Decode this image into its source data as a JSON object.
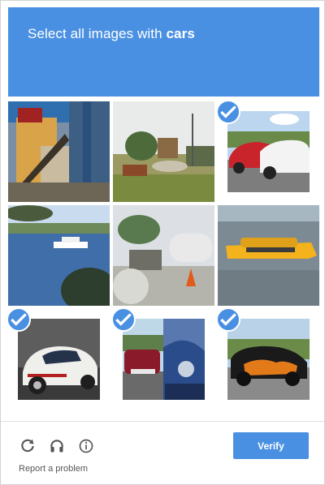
{
  "challenge": {
    "prompt_prefix": "Select all images with",
    "prompt_object": "cars"
  },
  "tiles": [
    {
      "name": "tile-industrial-interior",
      "selected": false
    },
    {
      "name": "tile-construction-site",
      "selected": false
    },
    {
      "name": "tile-red-white-cars",
      "selected": true
    },
    {
      "name": "tile-lake-boat",
      "selected": false
    },
    {
      "name": "tile-tanks-cone",
      "selected": false
    },
    {
      "name": "tile-yellow-boat",
      "selected": false
    },
    {
      "name": "tile-white-car",
      "selected": true
    },
    {
      "name": "tile-red-car-collage",
      "selected": true
    },
    {
      "name": "tile-flame-car",
      "selected": true
    }
  ],
  "footer": {
    "reload_icon": "reload-icon",
    "audio_icon": "headphones-icon",
    "info_icon": "info-icon",
    "report_label": "Report a problem",
    "verify_label": "Verify"
  },
  "colors": {
    "accent": "#4a90e2"
  }
}
